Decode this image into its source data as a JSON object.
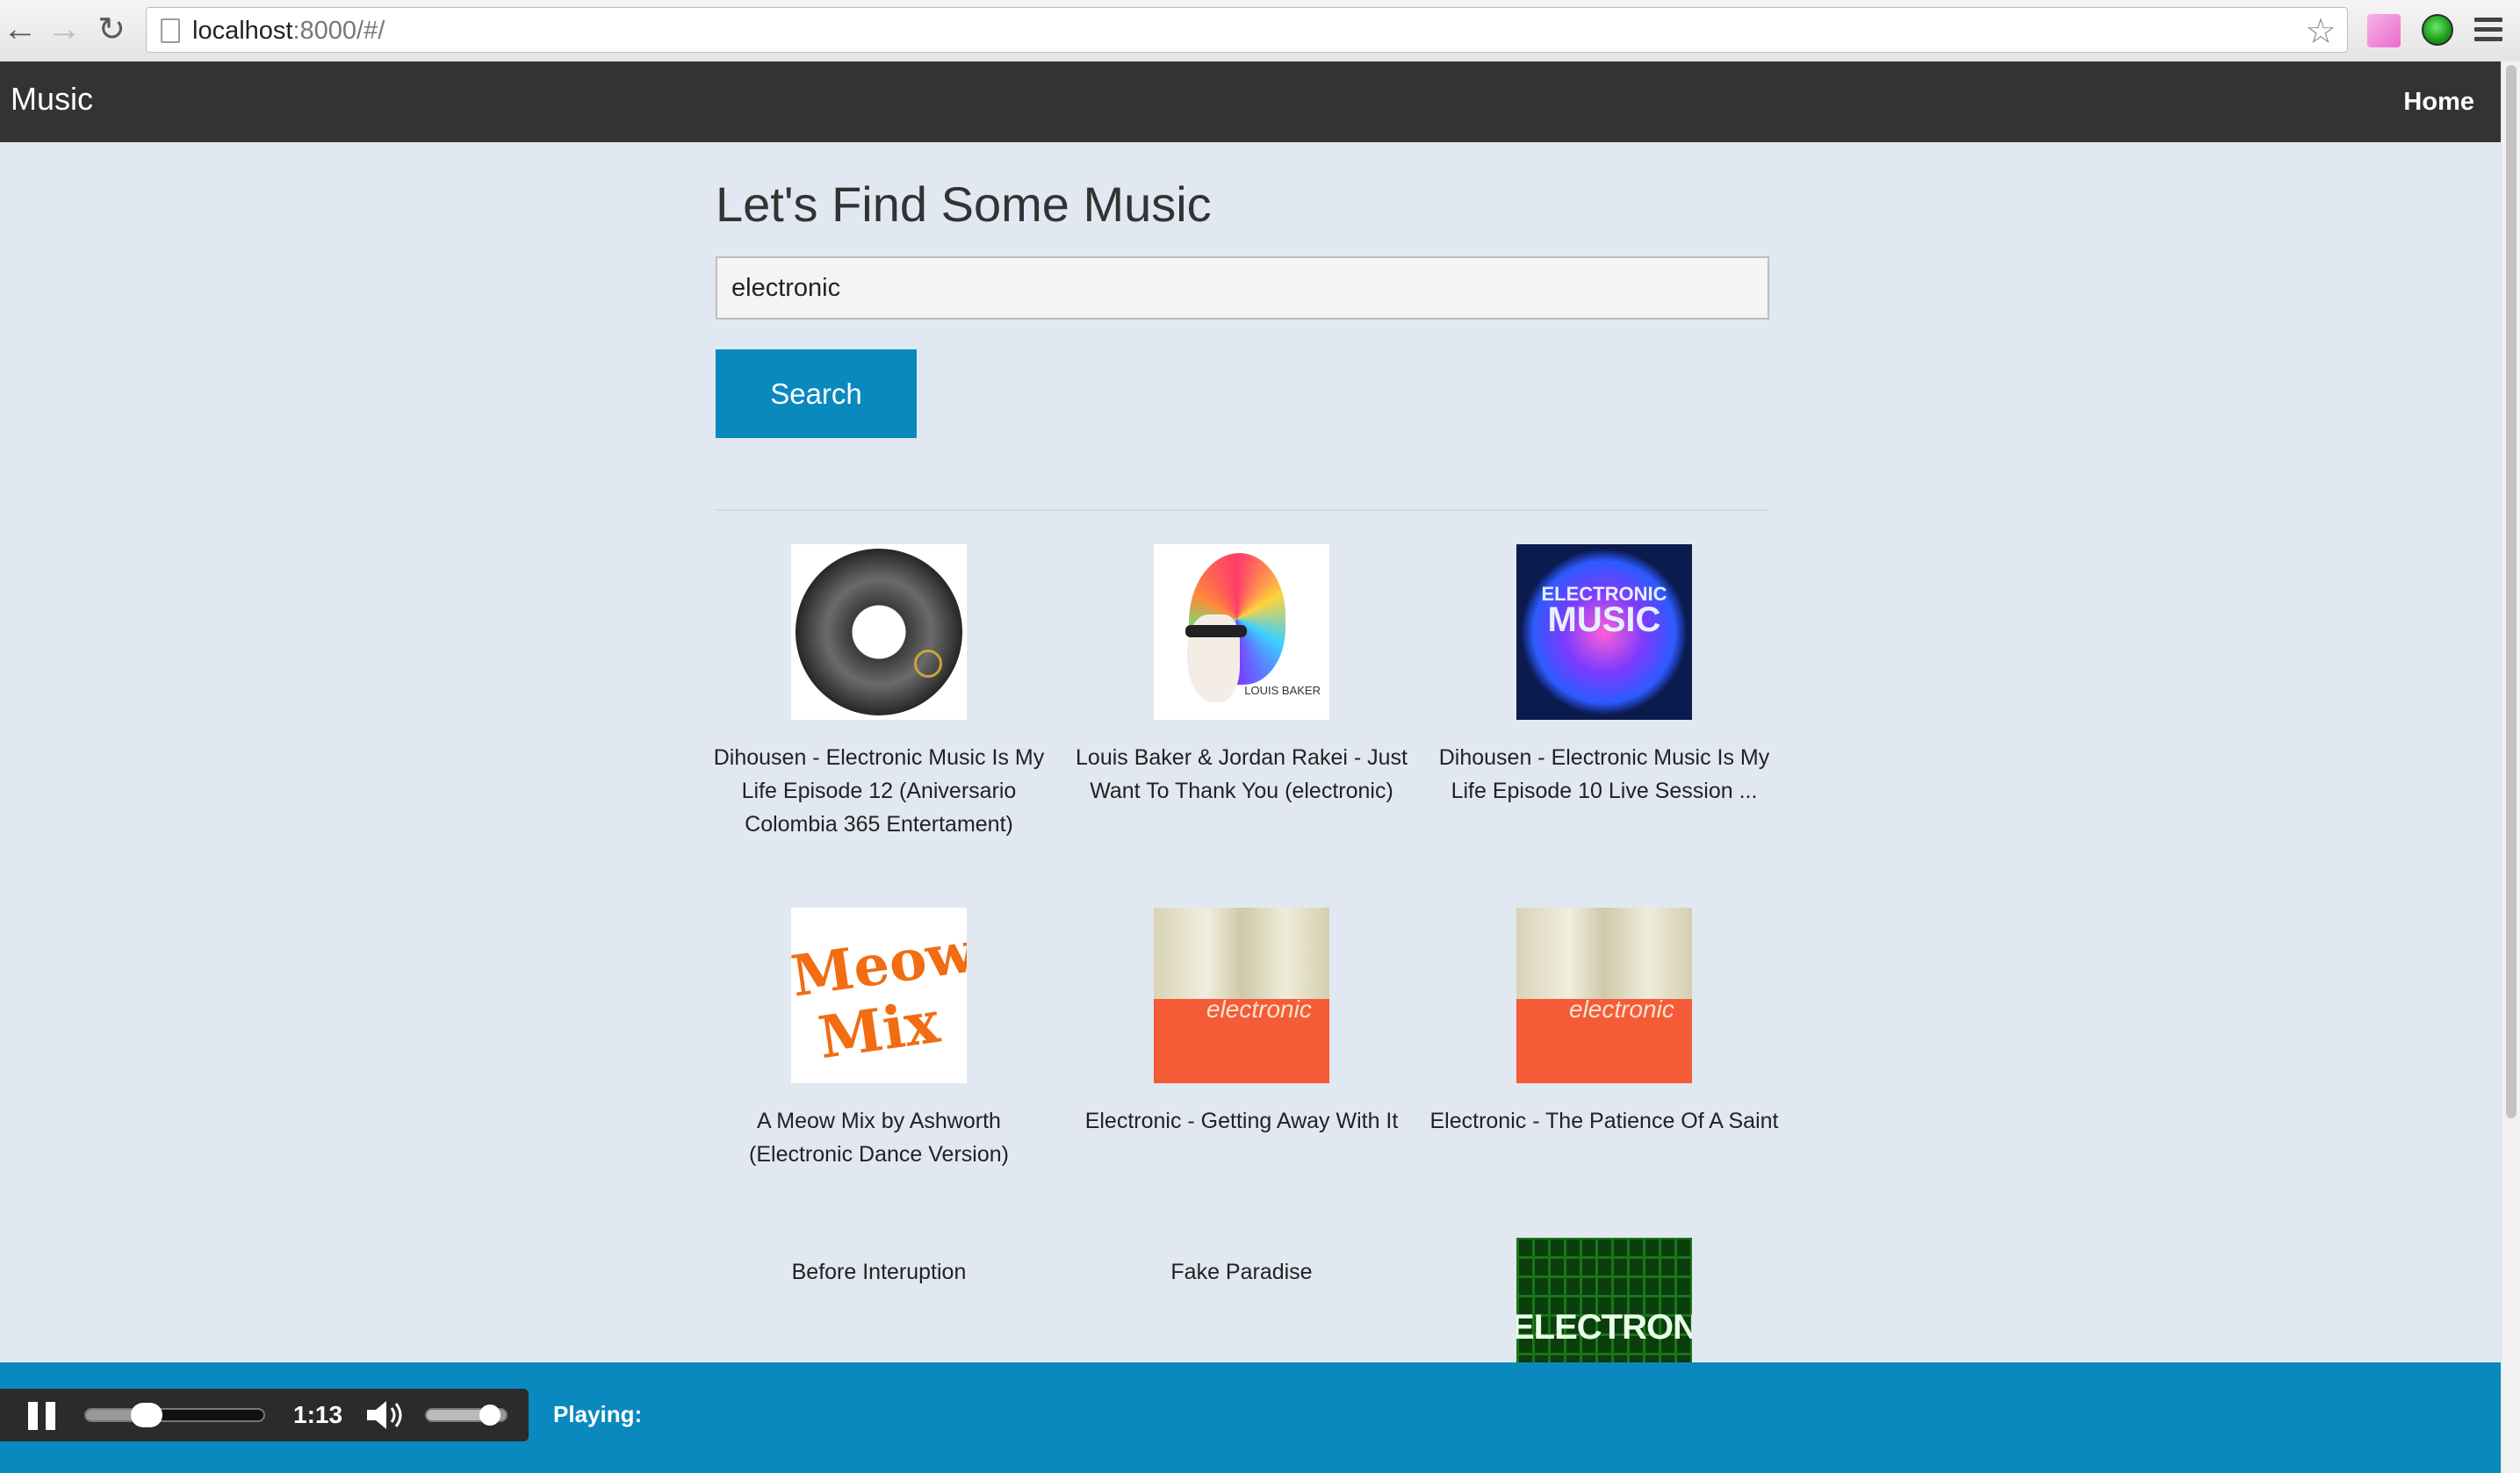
{
  "browser": {
    "url_host": "localhost",
    "url_path": ":8000/#/"
  },
  "navbar": {
    "brand": "Music",
    "home_link": "Home"
  },
  "main": {
    "title": "Let's Find Some Music",
    "search_value": "electronic",
    "search_button": "Search"
  },
  "results": [
    {
      "title": "Dihousen - Electronic Music Is My Life Episode 12 (Aniversario Colombia 365 Entertament)",
      "thumb": "cd-disc"
    },
    {
      "title": "Louis Baker & Jordan Rakei - Just Want To Thank You (electronic)",
      "thumb": "colorful-head",
      "thumb_text": "LOUIS BAKER"
    },
    {
      "title": "Dihousen - Electronic Music Is My Life Episode 10 Live Session ...",
      "thumb": "neon-circle",
      "thumb_text_1": "ELECTRONIC",
      "thumb_text_2": "MUSIC"
    },
    {
      "title": "A Meow Mix by Ashworth (Electronic Dance Version)",
      "thumb": "meow-mix-logo",
      "thumb_text_1": "Meow",
      "thumb_text_2": "Mix"
    },
    {
      "title": "Electronic - Getting Away With It",
      "thumb": "electronic-album",
      "thumb_text": "electronic"
    },
    {
      "title": "Electronic - The Patience Of A Saint",
      "thumb": "electronic-album",
      "thumb_text": "electronic"
    },
    {
      "title": "Before Interuption",
      "thumb": "none"
    },
    {
      "title": "Fake Paradise",
      "thumb": "none"
    },
    {
      "title": "",
      "thumb": "green-circuit",
      "thumb_text": "ELECTRONIC"
    }
  ],
  "player": {
    "time": "1:13",
    "playing_label": "Playing:",
    "seek_progress": 0.3,
    "volume_level": 0.85
  },
  "colors": {
    "page_bg": "#e1e8f1",
    "navbar_bg": "#333333",
    "accent": "#0a89bf"
  }
}
